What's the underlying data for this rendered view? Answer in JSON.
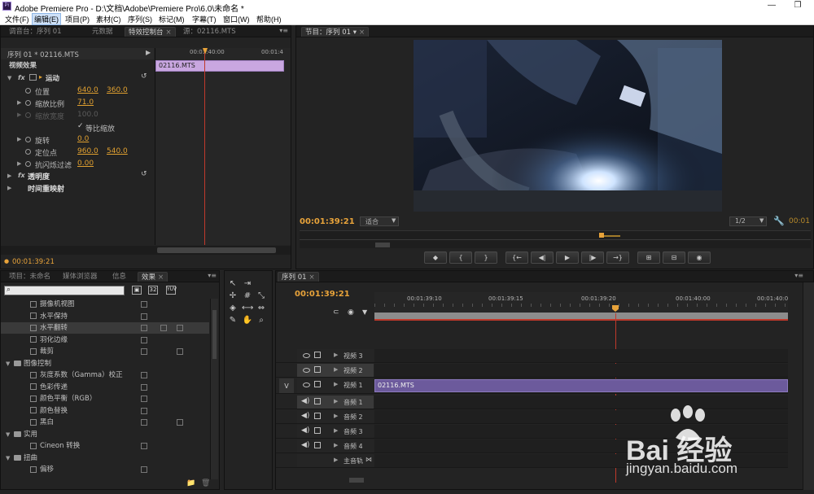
{
  "window": {
    "title": "Adobe Premiere Pro - D:\\文档\\Adobe\\Premiere Pro\\6.0\\未命名 *",
    "minimize": "—",
    "restore": "❐"
  },
  "menu": [
    "文件(F)",
    "编辑(E)",
    "项目(P)",
    "素材(C)",
    "序列(S)",
    "标记(M)",
    "字幕(T)",
    "窗口(W)",
    "帮助(H)"
  ],
  "top_left_panel": {
    "tabs": [
      "调音台：序列 01",
      "元数据",
      "特效控制台",
      "源：02116.MTS"
    ],
    "active_tab": 2
  },
  "effect_controls": {
    "clip_header": "序列 01 * 02116.MTS",
    "ruler_start": "00:01:40:00",
    "ruler_end": "00:01:4",
    "clip_name": "02116.MTS",
    "section": "视频效果",
    "motion": "运动",
    "position_label": "位置",
    "position_x": "640.0",
    "position_y": "360.0",
    "scale_label": "缩放比例",
    "scale": "71.0",
    "scale_width_label": "缩放宽度",
    "scale_width": "100.0",
    "uniform_label": "等比缩放",
    "rotation_label": "旋转",
    "rotation": "0.0",
    "anchor_label": "定位点",
    "anchor_x": "960.0",
    "anchor_y": "540.0",
    "flicker_label": "抗闪烁过滤",
    "flicker": "0.00",
    "opacity": "透明度",
    "time_remap": "时间重映射",
    "timecode": "00:01:39:21"
  },
  "program_monitor": {
    "tab": "节目：序列 01",
    "timecode": "00:01:39:21",
    "zoom": "适合",
    "resolution": "1/2",
    "duration": "00:01",
    "transport": [
      "◆",
      "{",
      "}",
      "{←",
      "◀|",
      "▶",
      "|▶",
      "→}",
      "⊞",
      "⊟",
      "◉"
    ]
  },
  "project_panel": {
    "tabs": [
      "项目：未命名",
      "媒体浏览器",
      "信息",
      "效果"
    ],
    "active_tab": 3,
    "search_placeholder": "",
    "items": [
      {
        "indent": 3,
        "type": "effect",
        "label": "摄像机视图"
      },
      {
        "indent": 3,
        "type": "effect",
        "label": "水平保持"
      },
      {
        "indent": 3,
        "type": "effect",
        "label": "水平翻转",
        "selected": true
      },
      {
        "indent": 3,
        "type": "effect",
        "label": "羽化边缘"
      },
      {
        "indent": 3,
        "type": "effect",
        "label": "裁剪"
      },
      {
        "indent": 2,
        "type": "folder",
        "label": "图像控制"
      },
      {
        "indent": 3,
        "type": "effect",
        "label": "灰度系数（Gamma）校正"
      },
      {
        "indent": 3,
        "type": "effect",
        "label": "色彩传递"
      },
      {
        "indent": 3,
        "type": "effect",
        "label": "颜色平衡（RGB）"
      },
      {
        "indent": 3,
        "type": "effect",
        "label": "颜色替换"
      },
      {
        "indent": 3,
        "type": "effect",
        "label": "黑白"
      },
      {
        "indent": 2,
        "type": "folder",
        "label": "实用"
      },
      {
        "indent": 3,
        "type": "effect",
        "label": "Cineon 转换"
      },
      {
        "indent": 2,
        "type": "folder",
        "label": "扭曲"
      },
      {
        "indent": 3,
        "type": "effect",
        "label": "偏移"
      }
    ]
  },
  "timeline": {
    "tab": "序列 01",
    "timecode": "00:01:39:21",
    "ruler": [
      "00:01:39:10",
      "00:01:39:15",
      "00:01:39:20",
      "00:01:40:00",
      "00:01:40:0"
    ],
    "tracks": [
      {
        "name": "视频 3",
        "kind": "video"
      },
      {
        "name": "视频 2",
        "kind": "video"
      },
      {
        "name": "视频 1",
        "kind": "video",
        "clip": "02116.MTS",
        "target": "V"
      },
      {
        "name": "音频 1",
        "kind": "audio"
      },
      {
        "name": "音频 2",
        "kind": "audio"
      },
      {
        "name": "音频 3",
        "kind": "audio"
      },
      {
        "name": "音频 4",
        "kind": "audio"
      },
      {
        "name": "主音轨",
        "kind": "master"
      }
    ]
  },
  "watermark": {
    "brand": "Bai 经验",
    "url": "jingyan.baidu.com"
  }
}
